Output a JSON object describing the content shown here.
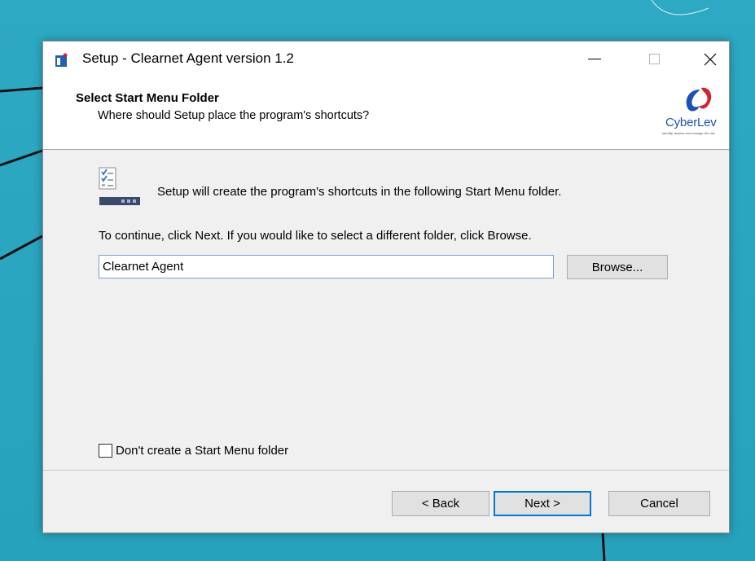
{
  "window": {
    "title": "Setup - Clearnet Agent version 1.2",
    "controls": {
      "minimize_icon": "minimize-icon",
      "maximize_icon": "maximize-icon",
      "close_icon": "close-icon"
    }
  },
  "header": {
    "title": "Select Start Menu Folder",
    "subtitle": "Where should Setup place the program's shortcuts?",
    "logo": {
      "word": "CyberLev",
      "tagline": "Identify, assess and manage the risk",
      "color": "#1d4fb5",
      "accent": "#d4202a"
    }
  },
  "main": {
    "intro": "Setup will create the program's shortcuts in the following Start Menu folder.",
    "instructions": "To continue, click Next. If you would like to select a different folder, click Browse.",
    "folder_value": "Clearnet Agent",
    "browse_label": "Browse...",
    "no_folder_label": "Don't create a Start Menu folder",
    "no_folder_checked": false
  },
  "footer": {
    "back_label": "< Back",
    "next_label": "Next >",
    "cancel_label": "Cancel"
  },
  "colors": {
    "desktop": "#2aa7c0",
    "focus": "#0078d7"
  }
}
